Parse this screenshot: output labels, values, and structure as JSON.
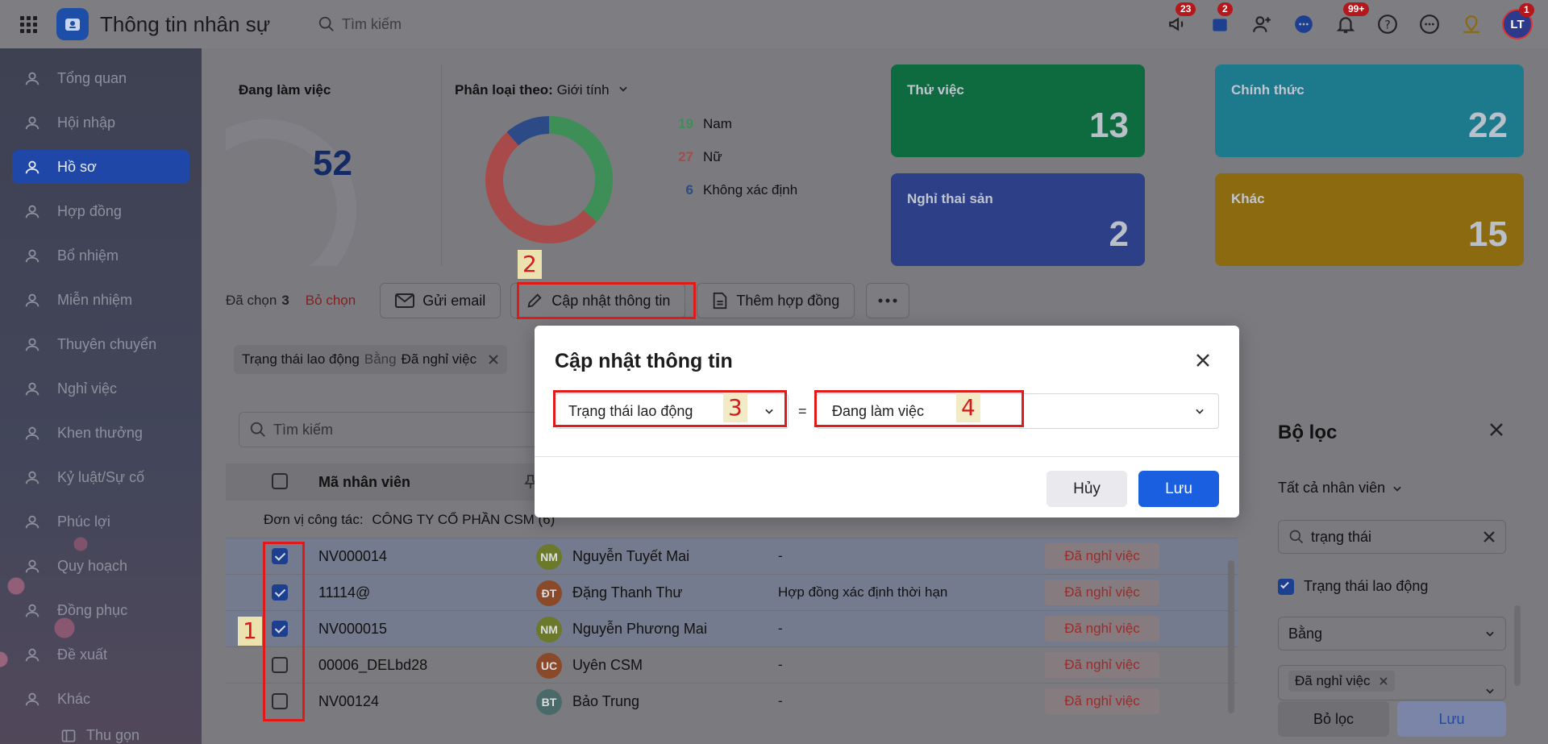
{
  "topbar": {
    "title": "Thông tin nhân sự",
    "search_placeholder": "Tìm kiếm",
    "badges": {
      "announce": "23",
      "cart": "2",
      "notifications": "99+",
      "avatar": "1"
    },
    "avatar_initials": "LT"
  },
  "sidebar": {
    "items": [
      {
        "label": "Tổng quan",
        "icon": "home-icon"
      },
      {
        "label": "Hội nhập",
        "icon": "onboarding-icon"
      },
      {
        "label": "Hồ sơ",
        "icon": "profile-icon",
        "active": true
      },
      {
        "label": "Hợp đồng",
        "icon": "contract-icon"
      },
      {
        "label": "Bổ nhiệm",
        "icon": "appoint-icon"
      },
      {
        "label": "Miễn nhiệm",
        "icon": "dismiss-icon"
      },
      {
        "label": "Thuyên chuyển",
        "icon": "transfer-icon"
      },
      {
        "label": "Nghỉ việc",
        "icon": "resign-icon"
      },
      {
        "label": "Khen thưởng",
        "icon": "reward-icon"
      },
      {
        "label": "Kỷ luật/Sự cố",
        "icon": "discipline-icon"
      },
      {
        "label": "Phúc lợi",
        "icon": "welfare-icon"
      },
      {
        "label": "Quy hoạch",
        "icon": "planning-icon"
      },
      {
        "label": "Đồng phục",
        "icon": "uniform-icon"
      },
      {
        "label": "Đề xuất",
        "icon": "proposal-icon"
      },
      {
        "label": "Khác",
        "icon": "more-icon"
      }
    ],
    "collapse_label": "Thu gọn"
  },
  "stats": {
    "working_label": "Đang làm việc",
    "working_value": "52",
    "classify_label": "Phân loại theo:",
    "classify_value": "Giới tính",
    "gender": [
      {
        "count": "19",
        "label": "Nam",
        "color": "#3e8e57"
      },
      {
        "count": "27",
        "label": "Nữ",
        "color": "#a84a4a"
      },
      {
        "count": "6",
        "label": "Không xác định",
        "color": "#2c4a86"
      }
    ],
    "tiles": [
      {
        "title": "Thử việc",
        "value": "13",
        "color": "#0e6a3f"
      },
      {
        "title": "Chính thức",
        "value": "22",
        "color": "#1c7a8c"
      },
      {
        "title": "Nghỉ thai sản",
        "value": "2",
        "color": "#2d3f86"
      },
      {
        "title": "Khác",
        "value": "15",
        "color": "#8c6a10"
      }
    ]
  },
  "actions": {
    "selected_prefix": "Đã chọn",
    "selected_count": "3",
    "deselect": "Bỏ chọn",
    "send_email": "Gửi email",
    "update_info": "Cập nhật thông tin",
    "add_contract": "Thêm hợp đồng"
  },
  "filter_chip": {
    "field": "Trạng thái lao động",
    "op": "Bằng",
    "value": "Đã nghỉ việc"
  },
  "table": {
    "search_placeholder": "Tìm kiếm",
    "col_code": "Mã nhân viên",
    "group_label": "Đơn vị công tác:",
    "group_value": "CÔNG TY CỔ PHẦN CSM (6)",
    "rows": [
      {
        "checked": true,
        "code": "NV000014",
        "initials": "NM",
        "av_color": "#6a7a2a",
        "name": "Nguyễn Tuyết Mai",
        "contract": "-",
        "status": "Đã nghỉ việc"
      },
      {
        "checked": true,
        "code": "11114@",
        "initials": "ĐT",
        "av_color": "#8a4a2a",
        "name": "Đặng Thanh Thư",
        "contract": "Hợp đồng xác định thời hạn",
        "status": "Đã nghỉ việc"
      },
      {
        "checked": true,
        "code": "NV000015",
        "initials": "NM",
        "av_color": "#6a7a2a",
        "name": "Nguyễn Phương Mai",
        "contract": "-",
        "status": "Đã nghỉ việc"
      },
      {
        "checked": false,
        "code": "00006_DELbd28",
        "initials": "UC",
        "av_color": "#8a4a2a",
        "name": "Uyên CSM",
        "contract": "-",
        "status": "Đã nghỉ việc"
      },
      {
        "checked": false,
        "code": "NV00124",
        "initials": "BT",
        "av_color": "#4a6a6a",
        "name": "Bảo Trung",
        "contract": "-",
        "status": "Đã nghỉ việc"
      }
    ]
  },
  "filter_panel": {
    "title": "Bộ lọc",
    "scope": "Tất cả nhân viên",
    "search_value": "trạng thái",
    "field_label": "Trạng thái lao động",
    "operator": "Bằng",
    "value_tag": "Đã nghỉ việc",
    "clear_btn": "Bỏ lọc",
    "save_btn": "Lưu"
  },
  "modal": {
    "title": "Cập nhật thông tin",
    "field": "Trạng thái lao động",
    "equals": "=",
    "value": "Đang làm việc",
    "cancel": "Hủy",
    "save": "Lưu"
  },
  "annotations": [
    "1",
    "2",
    "3",
    "4"
  ]
}
